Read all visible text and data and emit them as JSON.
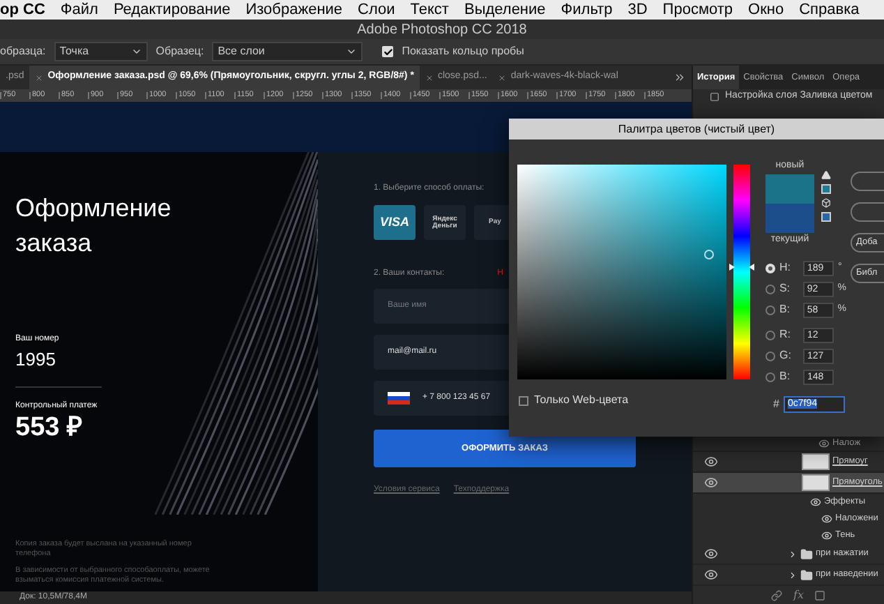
{
  "menu_bar": {
    "app": "ор CC",
    "items": [
      "Файл",
      "Редактирование",
      "Изображение",
      "Слои",
      "Текст",
      "Выделение",
      "Фильтр",
      "3D",
      "Просмотр",
      "Окно",
      "Справка"
    ]
  },
  "window": {
    "title": "Adobe Photoshop CC 2018"
  },
  "options_bar": {
    "sample_size_label": "образца:",
    "sample_size": "Точка",
    "sample_label": "Образец:",
    "sample": "Все слои",
    "show_ring": {
      "label": "Показать кольцо пробы",
      "checked": true
    }
  },
  "document_tabs": [
    {
      "label": ".psd",
      "selected": false
    },
    {
      "label": "Оформление заказа.psd @ 69,6% (Прямоугольник, скругл. углы 2, RGB/8#) *",
      "selected": true
    },
    {
      "label": "close.psd...",
      "selected": false
    },
    {
      "label": "dark-waves-4k-black-wal",
      "selected": false
    }
  ],
  "ruler": [
    "750",
    "800",
    "850",
    "900",
    "950",
    "1000",
    "1050",
    "1100",
    "1150",
    "1200",
    "1250",
    "1300",
    "1350",
    "1400",
    "1450",
    "1500",
    "1550",
    "1600",
    "1650",
    "1700",
    "1750",
    "1800",
    "1850"
  ],
  "canvas": {
    "title": "Оформление заказа",
    "order_label": "Ваш номер",
    "order_number": "1995",
    "payment_label": "Контрольный платеж",
    "payment_amount": "553 ₽",
    "notes": [
      "Копия заказа будет выслана на указанный номер телефона",
      "В зависимости от выбранного способаоплаты, можете взыматься комиссия платежной системы."
    ],
    "payment_heading": "1. Выберите способ оплаты:",
    "payment_methods": [
      {
        "label": "VISA",
        "selected": true
      },
      {
        "label": "Яндекс Деньги",
        "selected": false
      },
      {
        "label": "Pay",
        "selected": false
      }
    ],
    "contacts_heading": "2. Ваши контакты:",
    "contacts_note": "Н",
    "fields": [
      {
        "kind": "text",
        "placeholder": "Ваше имя"
      },
      {
        "kind": "text",
        "value": "mail@mail.ru"
      },
      {
        "kind": "phone",
        "value": "+ 7 800 123 45 67"
      }
    ],
    "submit": "ОФОРМИТЬ ЗАКАЗ",
    "links": [
      "Условия сервиса",
      "Техподдержка"
    ]
  },
  "status_bar": {
    "doc": "Док: 10,5M/78,4M"
  },
  "panel_tabs": [
    {
      "label": "История",
      "selected": true
    },
    {
      "label": "Свойства",
      "selected": false
    },
    {
      "label": "Символ",
      "selected": false
    },
    {
      "label": "Опера",
      "selected": false
    }
  ],
  "history_item": "Настройка слоя  Заливка цветом",
  "layers": [
    {
      "kind": "effect",
      "name": "Налож",
      "selected": false
    },
    {
      "kind": "layer",
      "name": "Прямоуг",
      "selected": false
    },
    {
      "kind": "layer",
      "name": "Прямоуголь",
      "selected": true,
      "children": [
        {
          "name": "Эффекты",
          "children": [
            {
              "name": "Наложени"
            },
            {
              "name": "Тень"
            }
          ]
        }
      ]
    },
    {
      "kind": "group",
      "name": "при нажатии",
      "selected": false,
      "expanded": false
    },
    {
      "kind": "group",
      "name": "при наведении",
      "selected": false,
      "expanded": false
    }
  ],
  "layers_footer": {
    "effects": "fx"
  },
  "color_picker": {
    "title": "Палитра цветов (чистый цвет)",
    "hue_slider": {
      "level": 0.525
    },
    "new_label": "новый",
    "current_label": "текущий",
    "values": [
      {
        "label": "H:",
        "value": "189",
        "unit": "°",
        "selected": true
      },
      {
        "label": "S:",
        "value": "92",
        "unit": "%",
        "selected": false
      },
      {
        "label": "B:",
        "value": "58",
        "unit": "%",
        "selected": false
      },
      {
        "label": "R:",
        "value": "12",
        "selected": false
      },
      {
        "label": "G:",
        "value": "127",
        "selected": false
      },
      {
        "label": "B:",
        "value": "148",
        "selected": false
      }
    ],
    "hex": {
      "label": "#",
      "value": "0c7f94"
    },
    "web_only": {
      "label": "Только Web-цвета",
      "checked": false
    },
    "buttons": [
      "Доба",
      "Библ"
    ]
  }
}
